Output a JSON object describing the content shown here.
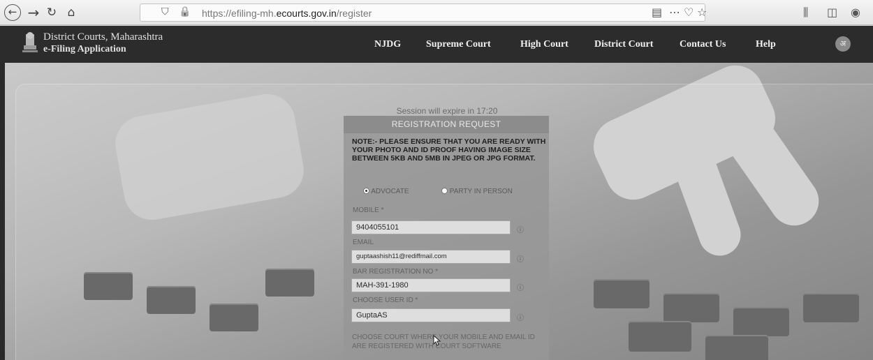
{
  "browser": {
    "url_prefix": "https://efiling-mh.",
    "url_domain": "ecourts.gov.in",
    "url_path": "/register"
  },
  "header": {
    "site_title": "District Courts, Maharashtra",
    "site_subtitle": "e-Filing Application",
    "nav": [
      "NJDG",
      "Supreme Court",
      "High Court",
      "District Court",
      "Contact Us",
      "Help"
    ]
  },
  "form": {
    "session_text": "Session will expire in 17:20",
    "title": "REGISTRATION REQUEST",
    "note": "NOTE:- PLEASE ENSURE THAT YOU ARE READY WITH YOUR PHOTO AND ID PROOF HAVING IMAGE SIZE BETWEEN 5KB AND 5MB IN JPEG OR JPG FORMAT.",
    "radio_advocate": "ADVOCATE",
    "radio_party": "PARTY IN PERSON",
    "selected_role": "ADVOCATE",
    "mobile_label": "MOBILE *",
    "mobile_value": "9404055101",
    "email_label": "EMAIL",
    "email_value": "guptaashish11@rediffmail.com",
    "bar_label": "BAR REGISTRATION NO *",
    "bar_value": "MAH-391-1980",
    "userid_label": "CHOOSE USER ID *",
    "userid_value": "GuptaAS",
    "choose_court": "CHOOSE COURT WHERE YOUR MOBILE AND EMAIL ID ARE REGISTERED WITH COURT SOFTWARE"
  },
  "icons": {
    "help": "help-circle-icon",
    "back": "back-arrow-icon"
  }
}
